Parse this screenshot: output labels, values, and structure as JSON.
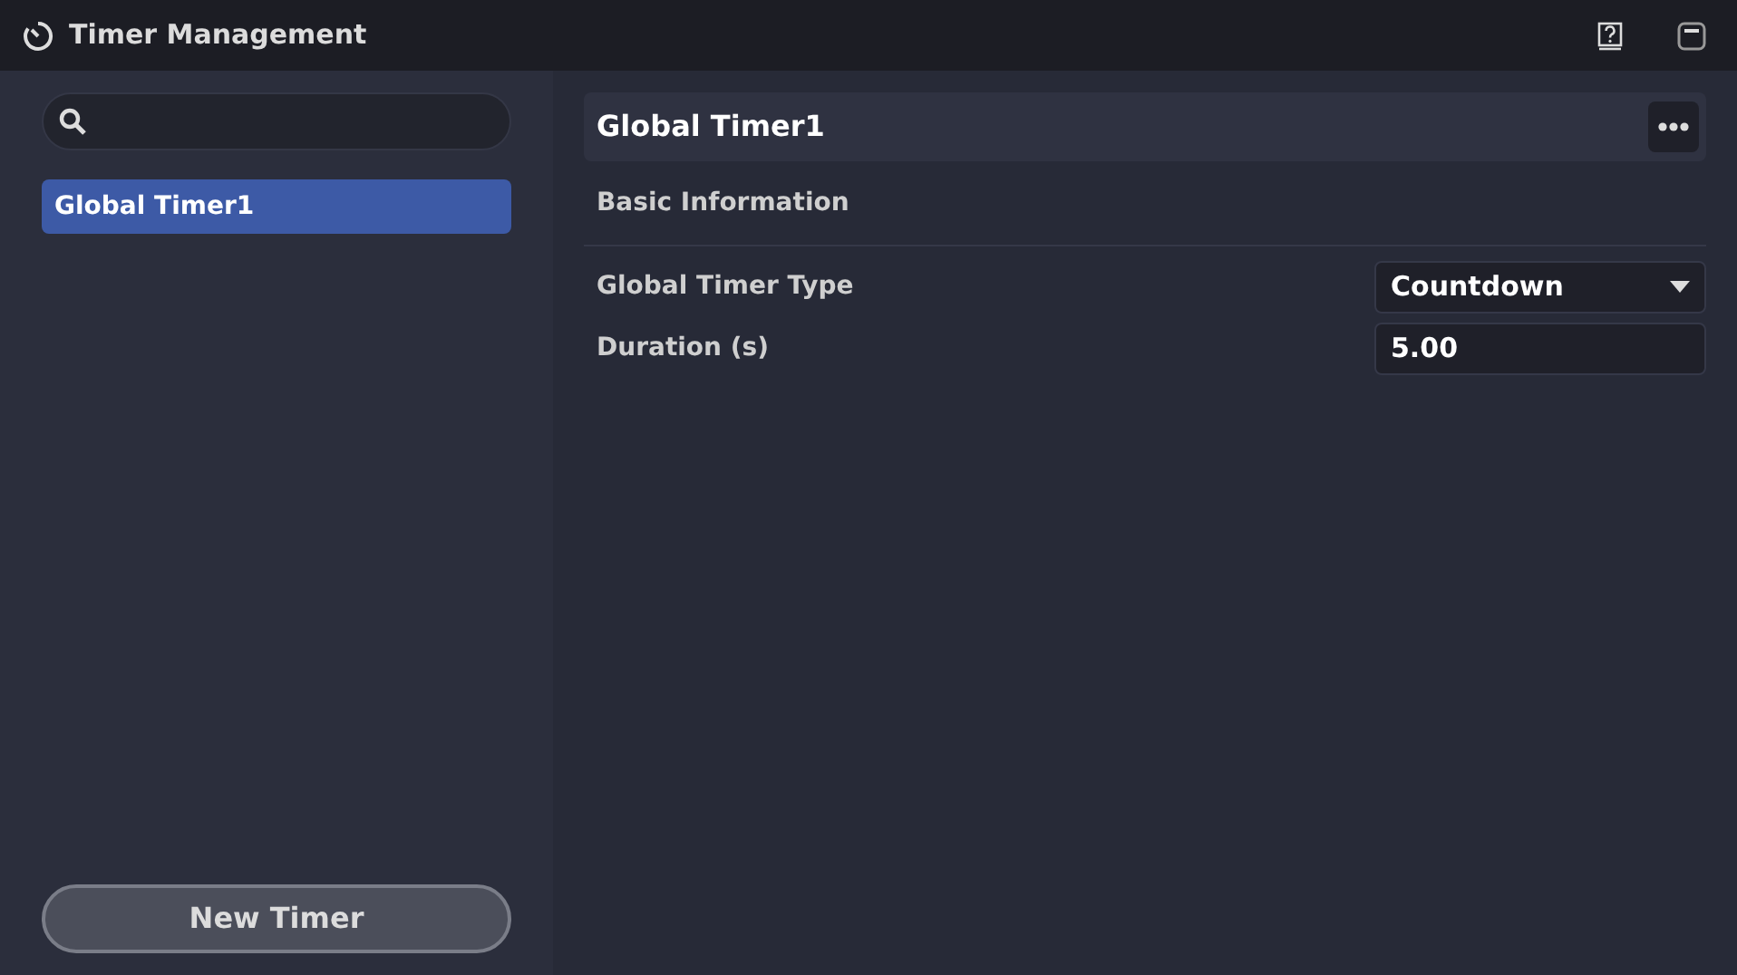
{
  "window": {
    "title": "Timer Management"
  },
  "sidebar": {
    "items": [
      {
        "label": "Global Timer1",
        "selected": true
      }
    ],
    "new_button": "New Timer"
  },
  "detail": {
    "title": "Global Timer1",
    "section": "Basic Information",
    "fields": [
      {
        "kind": "dropdown",
        "label": "Global Timer Type",
        "value": "Countdown"
      },
      {
        "kind": "input",
        "label": "Duration (s)",
        "value": "5.00"
      }
    ]
  }
}
